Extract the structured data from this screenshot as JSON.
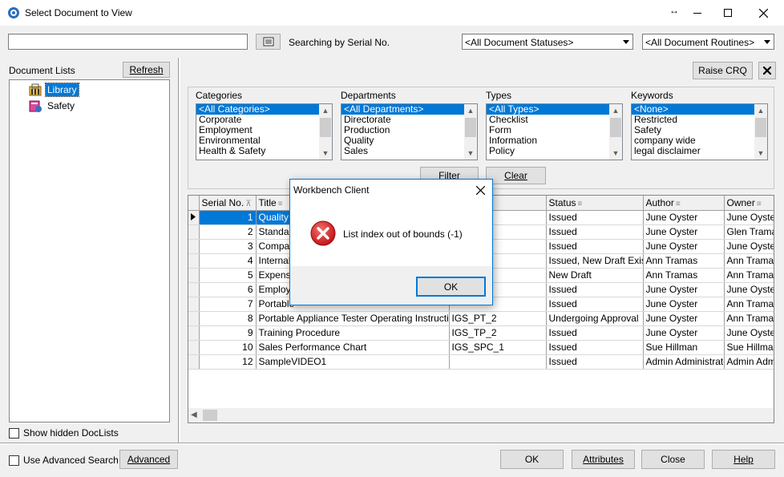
{
  "window": {
    "title": "Select Document to View"
  },
  "toolbar": {
    "search_value": "",
    "search_mode_label": "Searching by Serial No.",
    "status_filter": "<All Document Statuses>",
    "routine_filter": "<All Document Routines>"
  },
  "left": {
    "section_label": "Document Lists",
    "refresh_label": "Refresh",
    "tree": [
      {
        "label": "Library",
        "icon": "library-icon"
      },
      {
        "label": "Safety",
        "icon": "safety-icon"
      }
    ],
    "show_hidden_label": "Show hidden DocLists"
  },
  "right": {
    "raise_crq_label": "Raise CRQ",
    "filters": {
      "categories": {
        "label": "Categories",
        "items": [
          "<All Categories>",
          "Corporate",
          "Employment",
          "Environmental",
          "Health & Safety"
        ]
      },
      "departments": {
        "label": "Departments",
        "items": [
          "<All Departments>",
          "Directorate",
          "Production",
          "Quality",
          "Sales"
        ]
      },
      "types": {
        "label": "Types",
        "items": [
          "<All Types>",
          "Checklist",
          "Form",
          "Information",
          "Policy"
        ]
      },
      "keywords": {
        "label": "Keywords",
        "items": [
          "<None>",
          "Restricted",
          "Safety",
          "company wide",
          "legal disclaimer"
        ]
      }
    },
    "filter_label": "Filter",
    "clear_label": "Clear"
  },
  "grid": {
    "columns": [
      "Serial No.",
      "Title",
      "",
      "Status",
      "Author",
      "Owner"
    ],
    "rows": [
      [
        "1",
        "Quality M",
        "",
        "Issued",
        "June Oyster",
        "June Oyster"
      ],
      [
        "2",
        "Standard",
        "",
        "Issued",
        "June Oyster",
        "Glen Tramas"
      ],
      [
        "3",
        "Company",
        "",
        "Issued",
        "June Oyster",
        "June Oyster"
      ],
      [
        "4",
        "Internal",
        "",
        "Issued, New Draft Exists",
        "Ann Tramas",
        "Ann Tramas"
      ],
      [
        "5",
        "Expense",
        "",
        "New Draft",
        "Ann Tramas",
        "Ann Tramas"
      ],
      [
        "6",
        "Employe",
        "",
        "Issued",
        "June Oyster",
        "June Oyster"
      ],
      [
        "7",
        "Portable",
        "",
        "Issued",
        "June Oyster",
        "Ann Tramas"
      ],
      [
        "8",
        "Portable Appliance Tester Operating Instructions",
        "IGS_PT_2",
        "Undergoing Approval",
        "June Oyster",
        "Ann Tramas"
      ],
      [
        "9",
        "Training Procedure",
        "IGS_TP_2",
        "Issued",
        "June Oyster",
        "June Oyster"
      ],
      [
        "10",
        "Sales Performance Chart",
        "IGS_SPC_1",
        "Issued",
        "Sue Hillman",
        "Sue Hillman"
      ],
      [
        "12",
        "SampleVIDEO1",
        "",
        "Issued",
        "Admin Administrator",
        "Admin Admin"
      ]
    ]
  },
  "bottom": {
    "advanced_search_label": "Use Advanced Search",
    "advanced_label": "Advanced",
    "ok_label": "OK",
    "attributes_label": "Attributes",
    "close_label": "Close",
    "help_label": "Help"
  },
  "dialog": {
    "title": "Workbench Client",
    "message": "List index out of bounds (-1)",
    "ok_label": "OK"
  },
  "colors": {
    "selection": "#0078d7",
    "error_icon": "#d81e1e"
  }
}
